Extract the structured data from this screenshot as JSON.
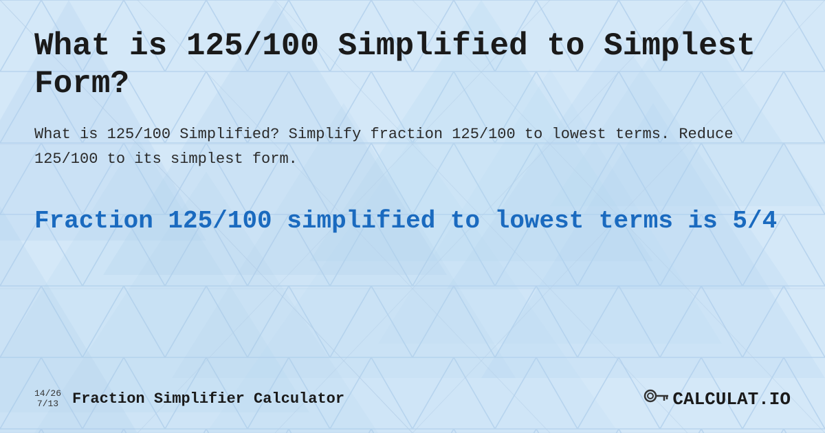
{
  "background": {
    "color": "#cce0f5"
  },
  "header": {
    "title": "What is 125/100 Simplified to Simplest Form?"
  },
  "description": {
    "text": "What is 125/100 Simplified? Simplify fraction 125/100 to lowest terms. Reduce 125/100 to its simplest form."
  },
  "result": {
    "title": "Fraction 125/100 simplified to lowest terms is 5/4"
  },
  "footer": {
    "fraction_top": "14/26",
    "fraction_bottom": "7/13",
    "label": "Fraction Simplifier Calculator",
    "logo_text": "CALCULAT.IO"
  }
}
